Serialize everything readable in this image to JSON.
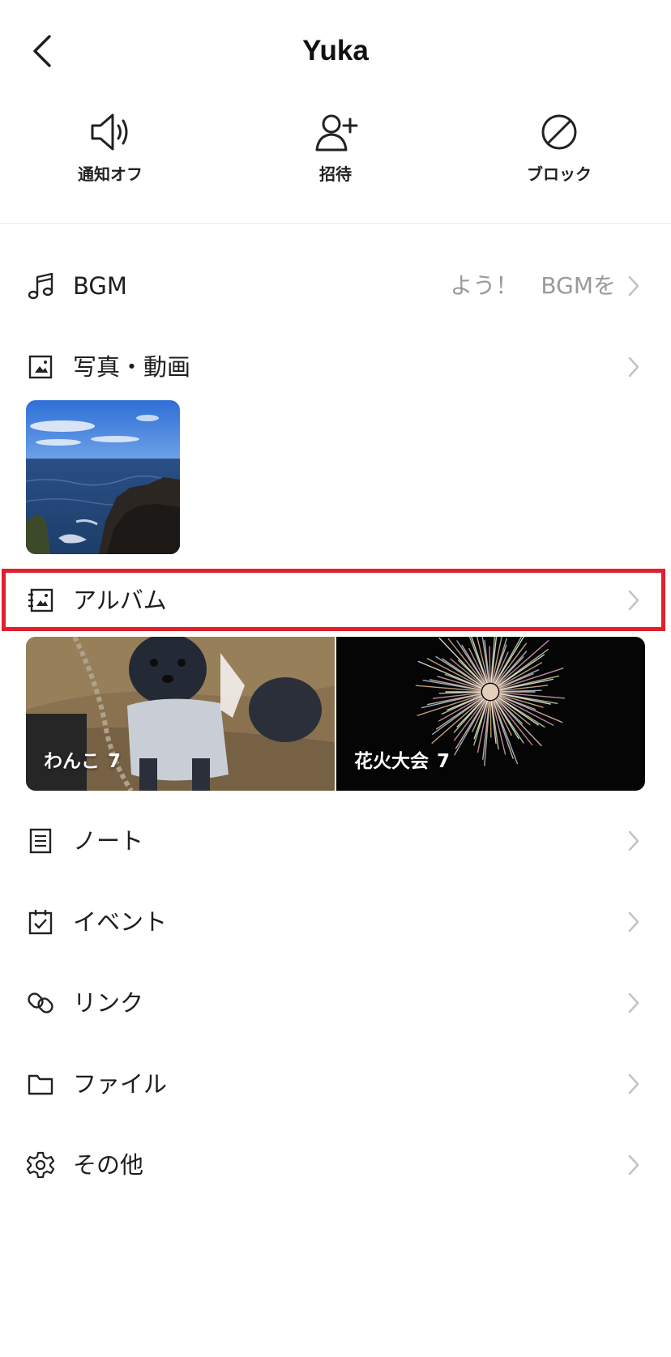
{
  "header": {
    "back_icon": "chevron-left-icon",
    "title": "Yuka"
  },
  "actions": [
    {
      "icon": "speaker-icon",
      "label": "通知オフ"
    },
    {
      "icon": "add-user-icon",
      "label": "招待"
    },
    {
      "icon": "block-icon",
      "label": "ブロック"
    }
  ],
  "menu": {
    "bgm": {
      "icon": "music-note-icon",
      "label": "BGM",
      "value": "よう！　BGMを"
    },
    "photos": {
      "icon": "photo-icon",
      "label": "写真・動画"
    },
    "album": {
      "icon": "album-icon",
      "label": "アルバム"
    },
    "note": {
      "icon": "note-icon",
      "label": "ノート"
    },
    "event": {
      "icon": "calendar-check-icon",
      "label": "イベント"
    },
    "link": {
      "icon": "link-icon",
      "label": "リンク"
    },
    "file": {
      "icon": "folder-icon",
      "label": "ファイル"
    },
    "other": {
      "icon": "gear-icon",
      "label": "その他"
    }
  },
  "albums": [
    {
      "name": "わんこ",
      "count": "7",
      "thumbnail": "dog-photo"
    },
    {
      "name": "花火大会",
      "count": "7",
      "thumbnail": "fireworks-photo"
    }
  ],
  "colors": {
    "highlight": "#e0202c",
    "text": "#1e1e1e",
    "secondary_text": "#9a9a9a",
    "chevron": "#c4c4c4"
  }
}
